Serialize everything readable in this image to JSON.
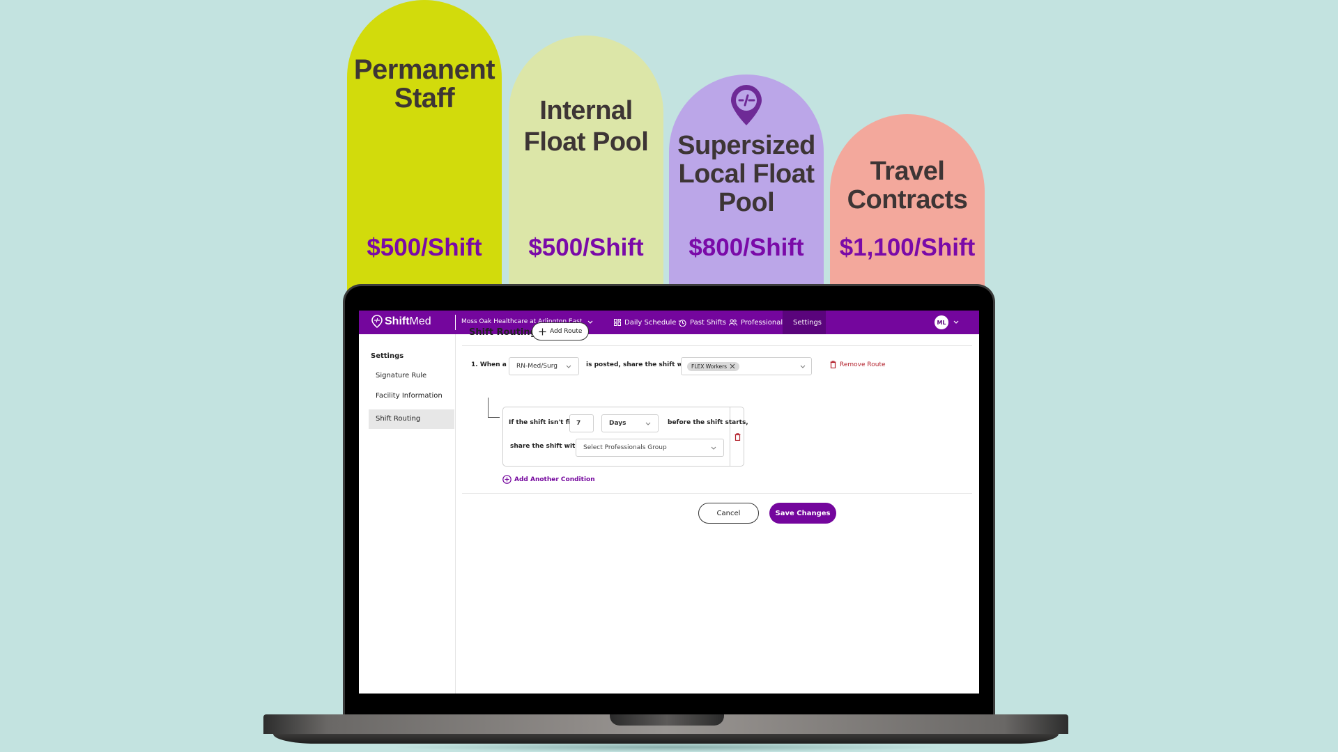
{
  "tiers": [
    {
      "title_lines": [
        "Permanent",
        "Staff"
      ],
      "price": "$500/Shift",
      "color": "#d2db0c"
    },
    {
      "title_lines": [
        "Internal",
        "Float Pool"
      ],
      "price": "$500/Shift",
      "color": "#dce6a8"
    },
    {
      "title_lines": [
        "Supersized",
        "Local Float",
        "Pool"
      ],
      "price": "$800/Shift",
      "color": "#bba6e8",
      "icon": "shiftmed-pin-icon"
    },
    {
      "title_lines": [
        "Travel",
        "Contracts"
      ],
      "price": "$1,100/Shift",
      "color": "#f3a89c"
    }
  ],
  "app": {
    "brand": {
      "bold": "Shift",
      "regular": "Med"
    },
    "facility": "Moss Oak Healthcare at Arlington East",
    "nav": [
      {
        "label": "Daily Schedule",
        "icon": "grid-icon"
      },
      {
        "label": "Past Shifts",
        "icon": "history-icon"
      },
      {
        "label": "Professionals",
        "icon": "people-icon"
      },
      {
        "label": "Settings",
        "icon": "gear-icon",
        "active": true
      }
    ],
    "user_initials": "ML",
    "accent": "#74069d",
    "sidebar": {
      "title": "Settings",
      "items": [
        {
          "label": "Signature Rule"
        },
        {
          "label": "Facility Information"
        },
        {
          "label": "Shift Routing",
          "active": true
        }
      ]
    },
    "main": {
      "title": "Shift Routing",
      "add_route": "Add Route",
      "route": {
        "prefix": "1. When a",
        "role_value": "RN-Med/Surg",
        "middle": "is posted, share the shift with:",
        "share_chip": "FLEX Workers",
        "remove_label": "Remove Route",
        "condition": {
          "if_label": "If the shift isn't filled",
          "amount": "7",
          "unit": "Days",
          "after_label": "before the shift starts,",
          "share_label": "share the shift with:",
          "group_placeholder": "Select Professionals Group"
        },
        "add_condition": "Add Another Condition"
      },
      "cancel": "Cancel",
      "save": "Save Changes"
    }
  }
}
